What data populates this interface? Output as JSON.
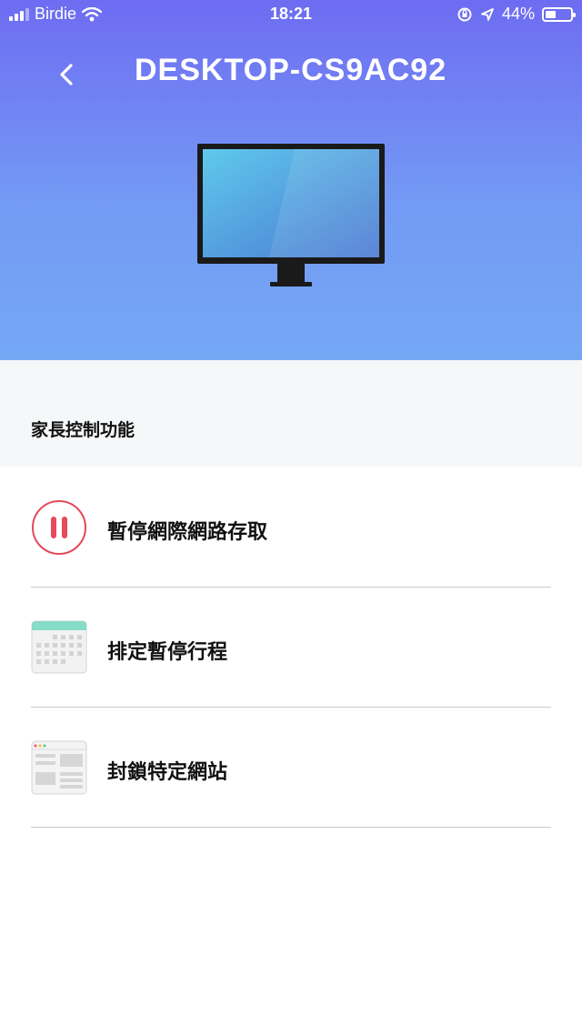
{
  "status_bar": {
    "carrier": "Birdie",
    "time": "18:21",
    "battery_percent": "44%",
    "battery_level": 0.44,
    "icons": [
      "signal-icon",
      "wifi-icon",
      "orientation-lock-icon",
      "location-arrow-icon",
      "battery-icon"
    ]
  },
  "header": {
    "title": "DESKTOP-CS9AC92",
    "back_icon": "chevron-left-icon",
    "device_icon": "desktop-monitor-icon"
  },
  "section": {
    "title": "家長控制功能"
  },
  "items": [
    {
      "label": "暫停網際網路存取",
      "icon": "pause-circle-icon"
    },
    {
      "label": "排定暫停行程",
      "icon": "calendar-icon"
    },
    {
      "label": "封鎖特定網站",
      "icon": "webpage-icon"
    }
  ],
  "colors": {
    "gradient_top": "#6e6cf2",
    "gradient_bottom": "#74a8f5",
    "pause_red": "#e5495a",
    "calendar_teal": "#86dcc6",
    "divider": "#c9c9c9",
    "section_bg": "#f5f7f8"
  }
}
